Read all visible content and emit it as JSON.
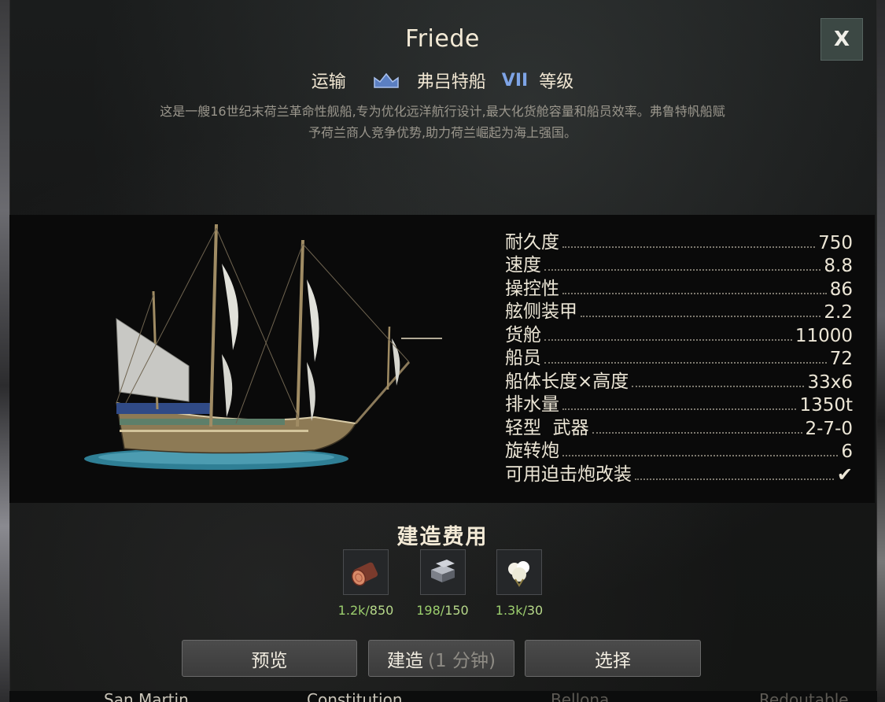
{
  "ship": {
    "name": "Friede",
    "type": "运输",
    "class_name": "弗吕特船",
    "tier": "VII",
    "tier_suffix": "等级",
    "description_line1": "这是一艘16世纪末荷兰革命性舰船,专为优化远洋航行设计,最大化货舱容量和船员效率。弗鲁特帆船赋",
    "description_line2": "予荷兰商人竞争优势,助力荷兰崛起为海上强国。"
  },
  "close_label": "X",
  "stats": [
    {
      "label": "耐久度",
      "value": "750"
    },
    {
      "label": "速度",
      "value": "8.8"
    },
    {
      "label": "操控性",
      "value": "86"
    },
    {
      "label": "舷侧装甲",
      "value": "2.2"
    },
    {
      "label": "货舱",
      "value": "11000"
    },
    {
      "label": "船员",
      "value": "72"
    },
    {
      "label": "船体长度×高度",
      "value": "33x6"
    },
    {
      "label": "排水量",
      "value": "1350t"
    },
    {
      "label": "轻型  武器",
      "value": "2-7-0"
    },
    {
      "label": "旋转炮",
      "value": "6"
    },
    {
      "label": "可用迫击炮改装",
      "value": "✔"
    }
  ],
  "cost": {
    "title": "建造费用",
    "resources": [
      {
        "icon": "wood-log-icon",
        "have": "1.2k",
        "need": "850"
      },
      {
        "icon": "stone-blocks-icon",
        "have": "198",
        "need": "150"
      },
      {
        "icon": "cotton-icon",
        "have": "1.3k",
        "need": "30"
      }
    ]
  },
  "buttons": {
    "preview": "预览",
    "build": "建造",
    "build_time": "(1 分钟)",
    "select": "选择"
  },
  "bottom_ships": [
    "San Martin",
    "Constitution",
    "Bellona",
    "Redoutable"
  ],
  "colors": {
    "tier": "#7ea4e6",
    "resource_amount": "#9ccf6e",
    "panel_bg": "#161717"
  }
}
